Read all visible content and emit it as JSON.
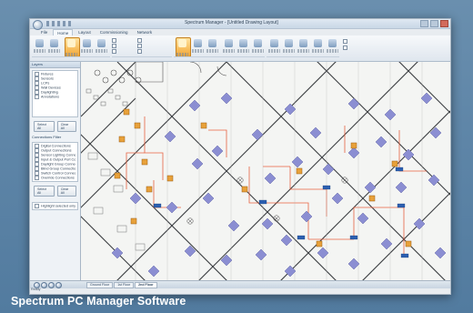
{
  "window": {
    "title": "Spectrum Manager - [Untitled Drawing Layout]"
  },
  "ribbon": {
    "tabs": [
      "File",
      "Home",
      "Layout",
      "Commissioning",
      "Network"
    ],
    "active_tab": "Home"
  },
  "left_panel": {
    "layers_header": "Layers",
    "layers": [
      "Fixtures",
      "Sensors",
      "LCPs",
      "Wall Devices",
      "Daylighting",
      "Annotations"
    ],
    "select_all": "Select All",
    "clear_all": "Clear All",
    "connections_header": "Connections Filter",
    "connections": [
      "Digital Connections",
      "Output Connections",
      "Sensor Lighting Connections",
      "Input & Output Port Connections",
      "Daylight Group Connections",
      "Blind Group Connections",
      "Switch Control Connections",
      "Override Connections"
    ],
    "select_all_2": "Select All",
    "clear_all_2": "Clear All",
    "highlight_option": "Highlight selected only"
  },
  "sheet_tabs": [
    "Ground Floor",
    "1st Floor",
    "2nd Floor"
  ],
  "active_sheet": "2nd Floor",
  "status": {
    "left": "Ready"
  },
  "caption": "Spectrum PC Manager Software",
  "colors": {
    "fixture": "#8b8ed2",
    "device": "#e8a13a",
    "wiring": "#e5532f",
    "port": "#2c5fb0",
    "walls": "#3a3d40",
    "accent": "#f2a531"
  }
}
